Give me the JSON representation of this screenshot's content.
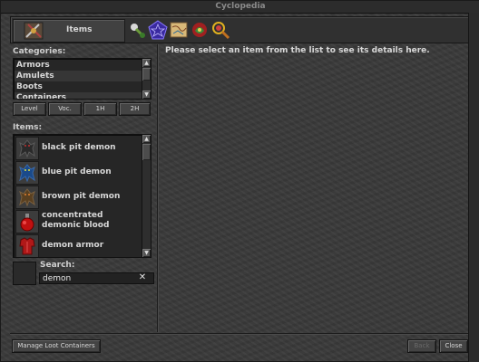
{
  "window": {
    "title": "Cyclopedia"
  },
  "tabs": {
    "active_label": "Items",
    "icons": [
      "items-icon",
      "bestiary-icon",
      "charms-icon",
      "map-icon",
      "houses-icon",
      "character-icon"
    ]
  },
  "categories": {
    "label": "Categories:",
    "items": [
      "Armors",
      "Amulets",
      "Boots",
      "Containers"
    ]
  },
  "filter_buttons": {
    "level": "Level",
    "voc": "Voc.",
    "one_hand": "1H",
    "two_hand": "2H"
  },
  "items": {
    "label": "Items:",
    "list": [
      {
        "name": "black pit demon",
        "icon": "black-pit-demon-icon"
      },
      {
        "name": "blue pit demon",
        "icon": "blue-pit-demon-icon"
      },
      {
        "name": "brown pit demon",
        "icon": "brown-pit-demon-icon"
      },
      {
        "name": "concentrated demonic blood",
        "icon": "demonic-blood-icon"
      },
      {
        "name": "demon armor",
        "icon": "demon-armor-icon"
      }
    ]
  },
  "search": {
    "label": "Search:",
    "value": "demon",
    "clear": "✕"
  },
  "details": {
    "placeholder": "Please select an item from the list to see its details here."
  },
  "footer": {
    "manage_loot": "Manage Loot Containers",
    "back": "Back",
    "close": "Close"
  }
}
